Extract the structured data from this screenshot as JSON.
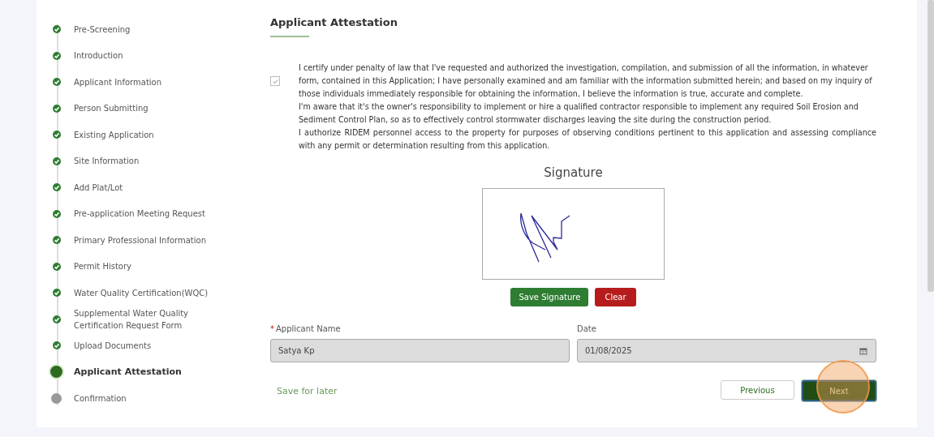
{
  "steps": [
    {
      "label": "Pre-Screening",
      "completed": true,
      "selected": false
    },
    {
      "label": "Introduction",
      "completed": true,
      "selected": false
    },
    {
      "label": "Applicant Information",
      "completed": true,
      "selected": false
    },
    {
      "label": "Person Submitting",
      "completed": true,
      "selected": false
    },
    {
      "label": "Existing Application",
      "completed": true,
      "selected": false
    },
    {
      "label": "Site Information",
      "completed": true,
      "selected": false
    },
    {
      "label": "Add Plat/Lot",
      "completed": true,
      "selected": false
    },
    {
      "label": "Pre-application Meeting Request",
      "completed": true,
      "selected": false
    },
    {
      "label": "Primary Professional Information",
      "completed": true,
      "selected": false
    },
    {
      "label": "Permit History",
      "completed": true,
      "selected": false
    },
    {
      "label": "Water Quality Certification(WQC)",
      "completed": true,
      "selected": false
    },
    {
      "label": "Supplemental Water Quality Certification Request Form",
      "completed": true,
      "selected": false
    },
    {
      "label": "Upload Documents",
      "completed": true,
      "selected": false
    },
    {
      "label": "Applicant Attestation",
      "completed": false,
      "selected": true
    },
    {
      "label": "Confirmation",
      "completed": false,
      "selected": false
    }
  ],
  "section_title": "Applicant Attestation",
  "attestation": {
    "checked": true,
    "paragraphs": [
      "I certify under penalty of law that I've requested and authorized the investigation, compilation, and submission of all the information, in whatever form, contained in this Application; I have personally examined and am familiar with the information submitted herein; and based on my inquiry of those individuals immediately responsible for obtaining the information, I believe the information is true, accurate and complete.",
      "I'm aware that it's the owner's responsibility to implement or hire a qualified contractor responsible to implement any required Soil Erosion and Sediment Control Plan, so as to effectively control stormwater discharges leaving the site during the construction period.",
      "I authorize RIDEM personnel access to the property for purposes of observing conditions pertinent to this application and assessing compliance with any permit or determination resulting from this application."
    ]
  },
  "signature": {
    "title": "Signature",
    "buttons": [
      "Save Signature",
      "Clear"
    ]
  },
  "fields": [
    {
      "label": "Applicant Name",
      "required": true,
      "value": "Satya Kp",
      "kind": "text"
    },
    {
      "label": "Date",
      "required": false,
      "value": "01/08/2025",
      "kind": "date"
    }
  ],
  "footer": {
    "save_link": "Save for later",
    "previous": "Previous",
    "next": "Next"
  }
}
